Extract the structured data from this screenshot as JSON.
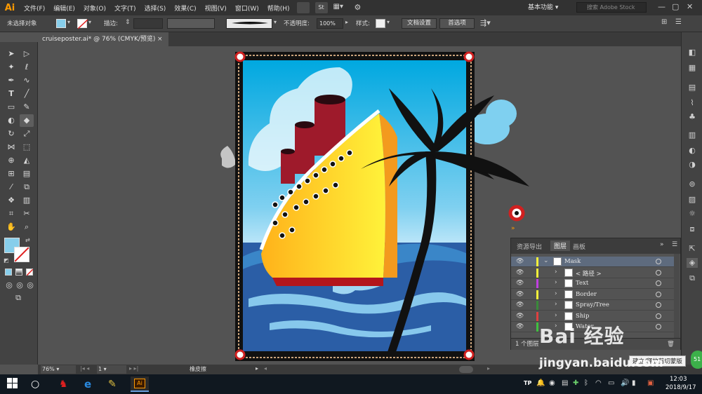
{
  "app": {
    "logo": "Ai"
  },
  "menu": [
    "文件(F)",
    "编辑(E)",
    "对象(O)",
    "文字(T)",
    "选择(S)",
    "效果(C)",
    "视图(V)",
    "窗口(W)",
    "帮助(H)"
  ],
  "menubar_icons": {
    "st": "St"
  },
  "workspace": {
    "label": "基本功能"
  },
  "stock_search": {
    "placeholder": "搜索 Adobe Stock"
  },
  "controlbar": {
    "selection_label": "未选择对象",
    "stroke_label": "描边:",
    "opacity_label": "不透明度:",
    "opacity_value": "100%",
    "style_label": "样式:",
    "doc_setup_button": "文档设置",
    "preferences_button": "首选项"
  },
  "document_tab": {
    "title": "cruiseposter.ai* @ 76% (CMYK/预览)",
    "close": "×"
  },
  "layers_panel": {
    "tabs": [
      "资源导出",
      "图层",
      "画板"
    ],
    "active_tab": 1,
    "layers": [
      {
        "name": "Mask",
        "color": "#f5f03a",
        "expanded": true,
        "indent": 0
      },
      {
        "name": "< 路径 >",
        "color": "#f5f03a",
        "expanded": false,
        "indent": 1
      },
      {
        "name": "Text",
        "color": "#c040e0",
        "expanded": false,
        "indent": 1
      },
      {
        "name": "Border",
        "color": "#f5f03a",
        "expanded": false,
        "indent": 1
      },
      {
        "name": "Spray/Tree",
        "color": "#3a8a3a",
        "expanded": false,
        "indent": 1
      },
      {
        "name": "Ship",
        "color": "#e04040",
        "expanded": false,
        "indent": 1
      },
      {
        "name": "Water",
        "color": "#40c040",
        "expanded": false,
        "indent": 1
      }
    ],
    "footer": "1 个图层"
  },
  "statusbar": {
    "zoom": "76%",
    "artboard": "1",
    "tool": "橡皮擦"
  },
  "tooltip": "建立/释放剪切蒙版",
  "watermark": {
    "brand": "Bai 经验",
    "url": "jingyan.baidu.com"
  },
  "taskbar": {
    "time": "12:03",
    "date": "2018/9/17",
    "ime": "TP",
    "badge": "51"
  },
  "colors": {
    "accent": "#ff9a00",
    "sky": "#28aee0",
    "ship_hull": "#ffc820",
    "water": "#2b5ea6",
    "funnel": "#9e1a2b"
  }
}
